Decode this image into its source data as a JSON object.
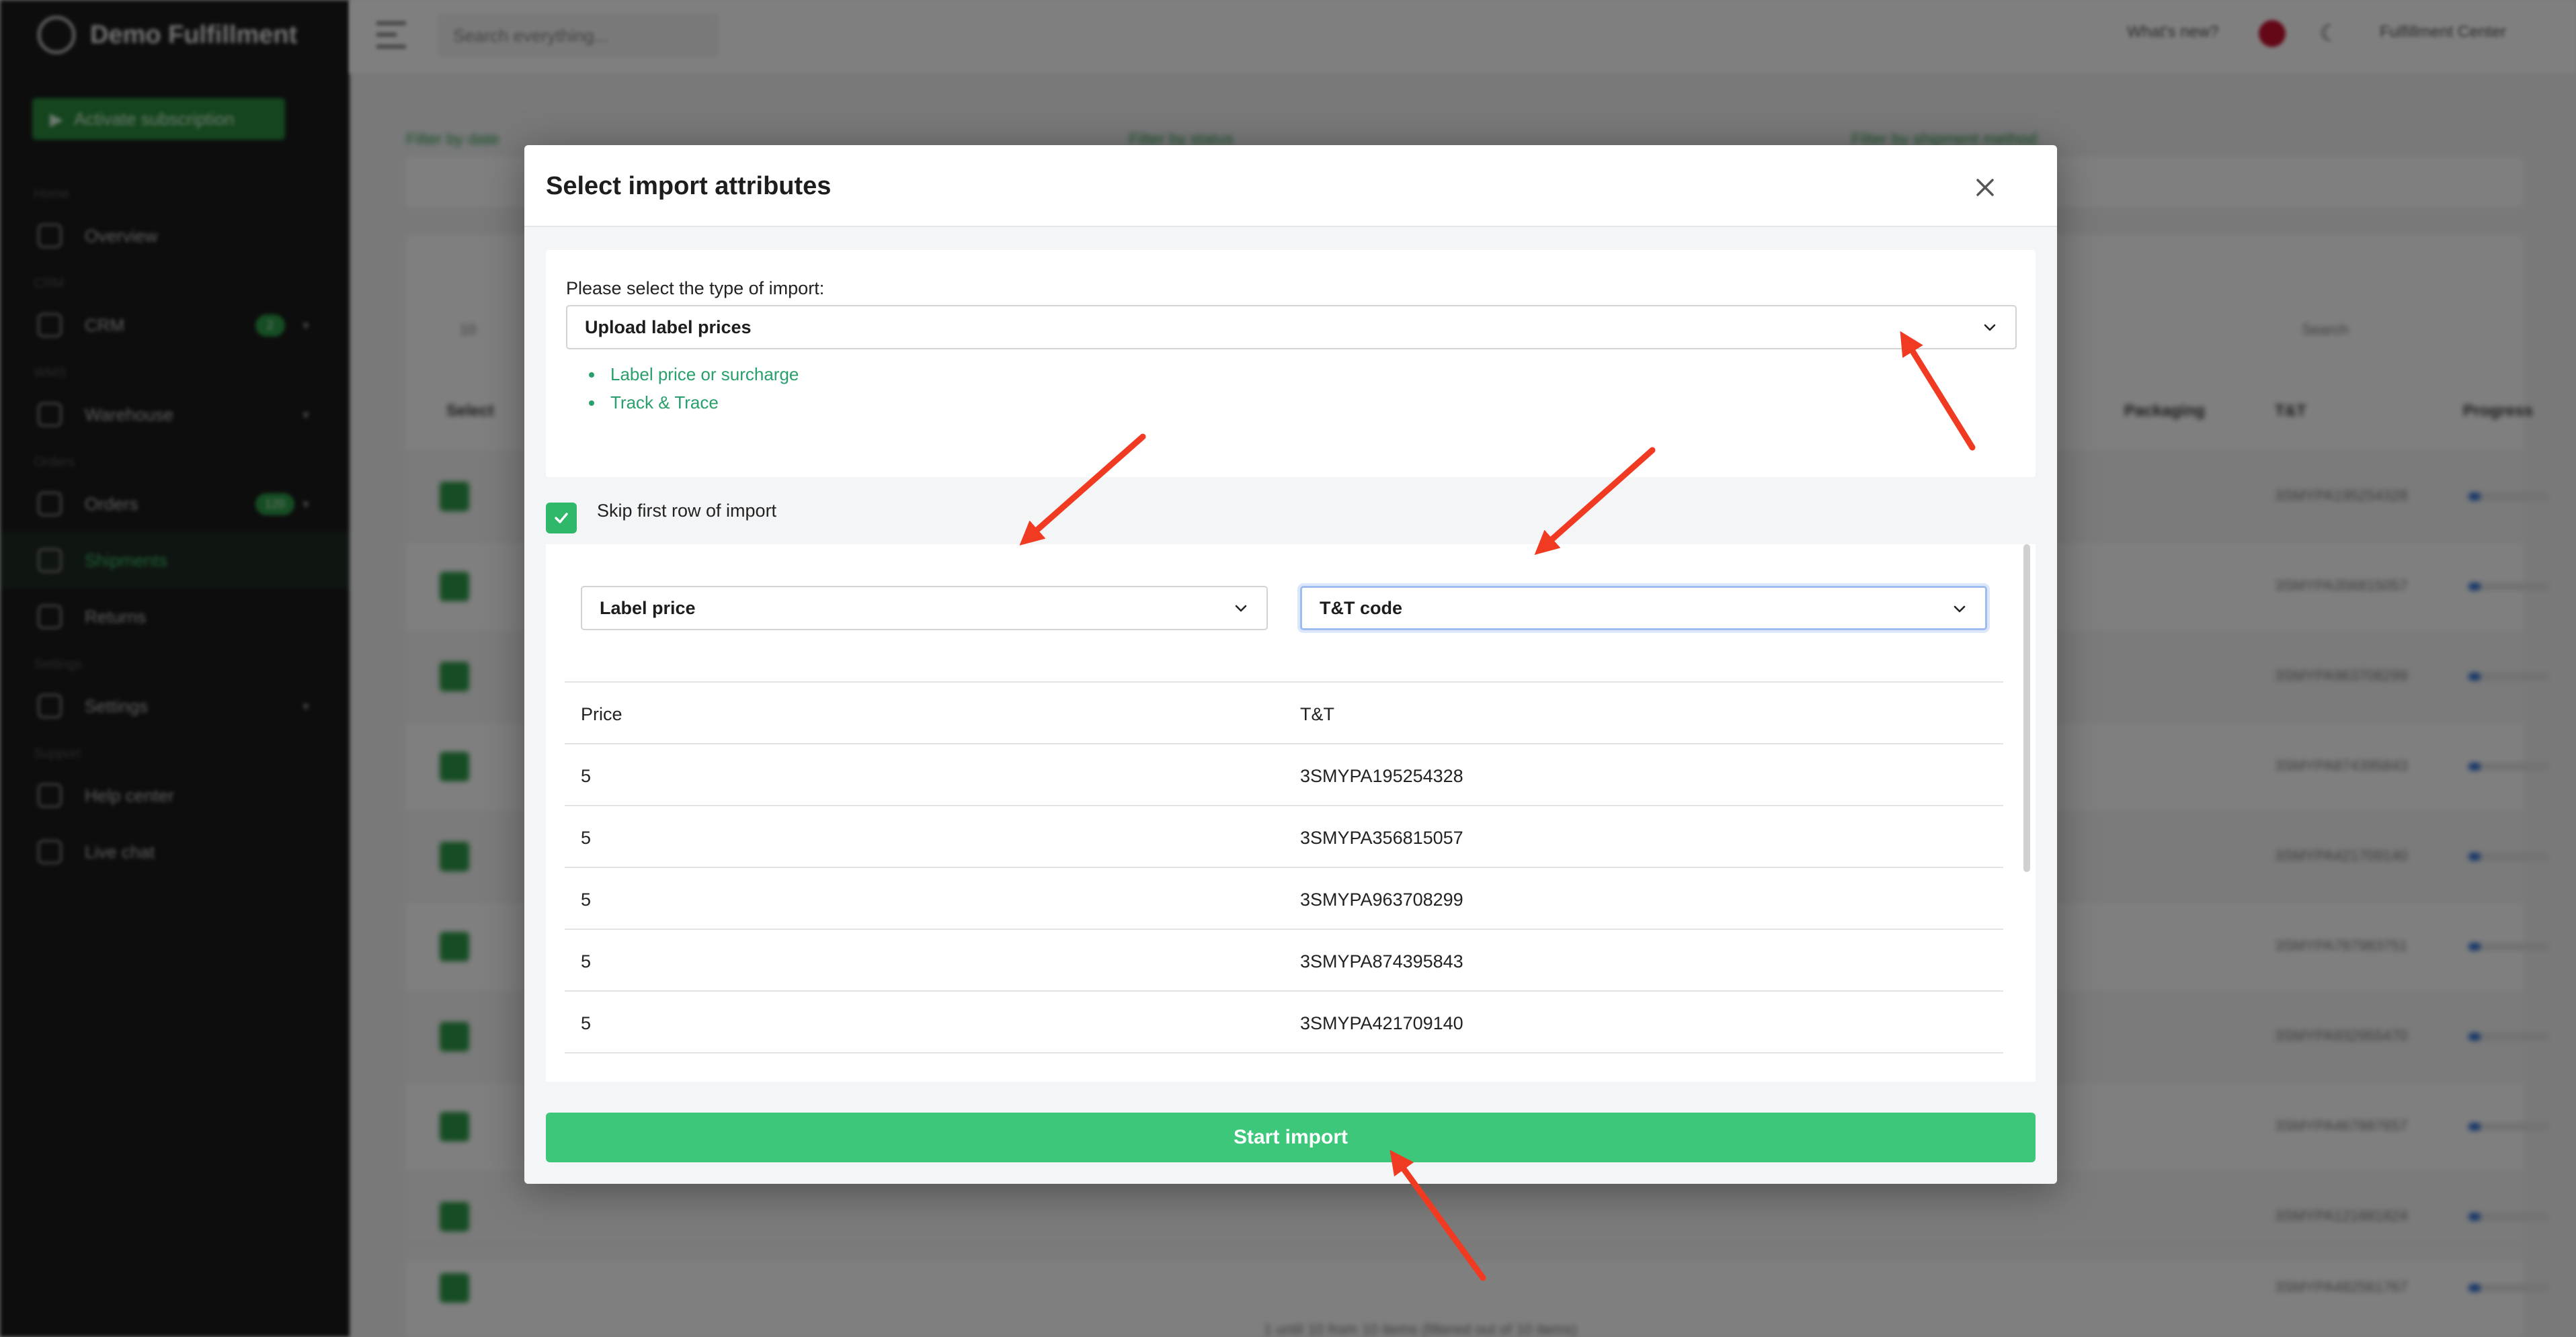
{
  "app": {
    "brand": "Demo Fulfillment",
    "subscription_button": "Activate subscription",
    "nav": [
      {
        "section": "Home",
        "label": "Overview"
      },
      {
        "section": "CRM",
        "label": "CRM",
        "badge": "2"
      },
      {
        "section": "WMS",
        "label": "Warehouse"
      },
      {
        "section": "Orders",
        "label": "Orders",
        "badge": "120"
      },
      {
        "section": "",
        "label": "Shipments"
      },
      {
        "section": "",
        "label": "Returns"
      },
      {
        "section": "Settings",
        "label": "Settings"
      },
      {
        "section": "Support",
        "label": "Help center"
      },
      {
        "section": "",
        "label": "Live chat"
      }
    ],
    "search_placeholder": "Search everything...",
    "whats_new": "What's new?",
    "account": "Fulfillment Center"
  },
  "background": {
    "filter_labels": [
      "Filter by date",
      "Filter by status",
      "Filter by shipment method"
    ],
    "table_search": "Search",
    "page_size": "10",
    "columns": [
      "Select",
      "Packaging",
      "T&T",
      "Progress"
    ],
    "rows": [
      {
        "tt": "3SMYPA195254328"
      },
      {
        "tt": "3SMYPA356815057"
      },
      {
        "tt": "3SMYPA963708299"
      },
      {
        "tt": "3SMYPA874395843"
      },
      {
        "tt": "3SMYPA421709140"
      },
      {
        "tt": "3SMYPA787983751"
      },
      {
        "tt": "3SMYPA932955470"
      },
      {
        "tt": "3SMYPA467887657"
      },
      {
        "tt": "3SMYPA121881824"
      },
      {
        "tt": "3SMYPA482561767"
      }
    ],
    "footer": "1 until 10 from 10 items (filtered out of 10 items)"
  },
  "modal": {
    "title": "Select import attributes",
    "type_label": "Please select the type of import:",
    "type_value": "Upload label prices",
    "attributes": [
      "Label price or surcharge",
      "Track & Trace"
    ],
    "skip_label": "Skip first row of import",
    "skip_checked": true,
    "column_selects": [
      "Label price",
      "T&T code"
    ],
    "preview_header": [
      "Price",
      "T&T"
    ],
    "preview_rows": [
      [
        "5",
        "3SMYPA195254328"
      ],
      [
        "5",
        "3SMYPA356815057"
      ],
      [
        "5",
        "3SMYPA963708299"
      ],
      [
        "5",
        "3SMYPA874395843"
      ],
      [
        "5",
        "3SMYPA421709140"
      ]
    ],
    "start_button": "Start import"
  },
  "colors": {
    "accent": "#3cc77a",
    "link_green": "#29a06b",
    "annotation_arrow": "#f03a22"
  }
}
